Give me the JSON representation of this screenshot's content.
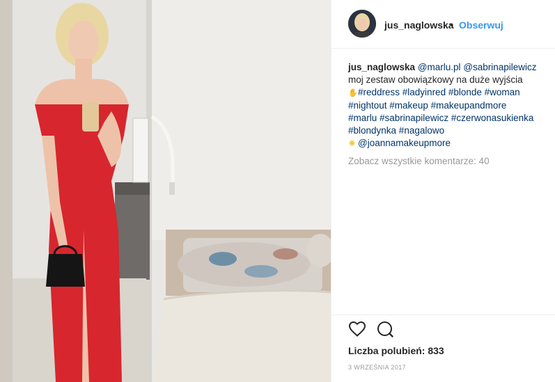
{
  "post": {
    "username": "jus_naglowska",
    "separator": "•",
    "follow_label": "Obserwuj",
    "caption": {
      "username": "jus_naglowska",
      "mention_1": "@marlu.pl",
      "mention_2": "@sabrinapilewicz",
      "line_1": "moj zestaw obowiązkowy na duże wyjścia",
      "hashtags_line_1": "#reddress #ladyinred #blonde #woman",
      "hashtags_line_2": "#nightout #makeup #makeupandmore",
      "hashtags_line_3": "#marlu #sabrinapilewicz #czerwonasukienka",
      "hashtags_line_4": "#blondynka #nagalowo",
      "mention_3": "@joannamakeupmore",
      "emoji_1": "hand-emoji",
      "emoji_2": "sun-emoji"
    },
    "view_comments": "Zobacz wszystkie komentarze: 40",
    "likes": "Liczba polubień: 833",
    "date": "3 WRZEŚNIA 2017"
  },
  "icons": {
    "like": "heart-icon",
    "comment": "comment-icon"
  },
  "colors": {
    "link": "#003569",
    "follow": "#3897f0",
    "muted": "#999999",
    "text": "#262626",
    "dress": "#d7262e"
  }
}
